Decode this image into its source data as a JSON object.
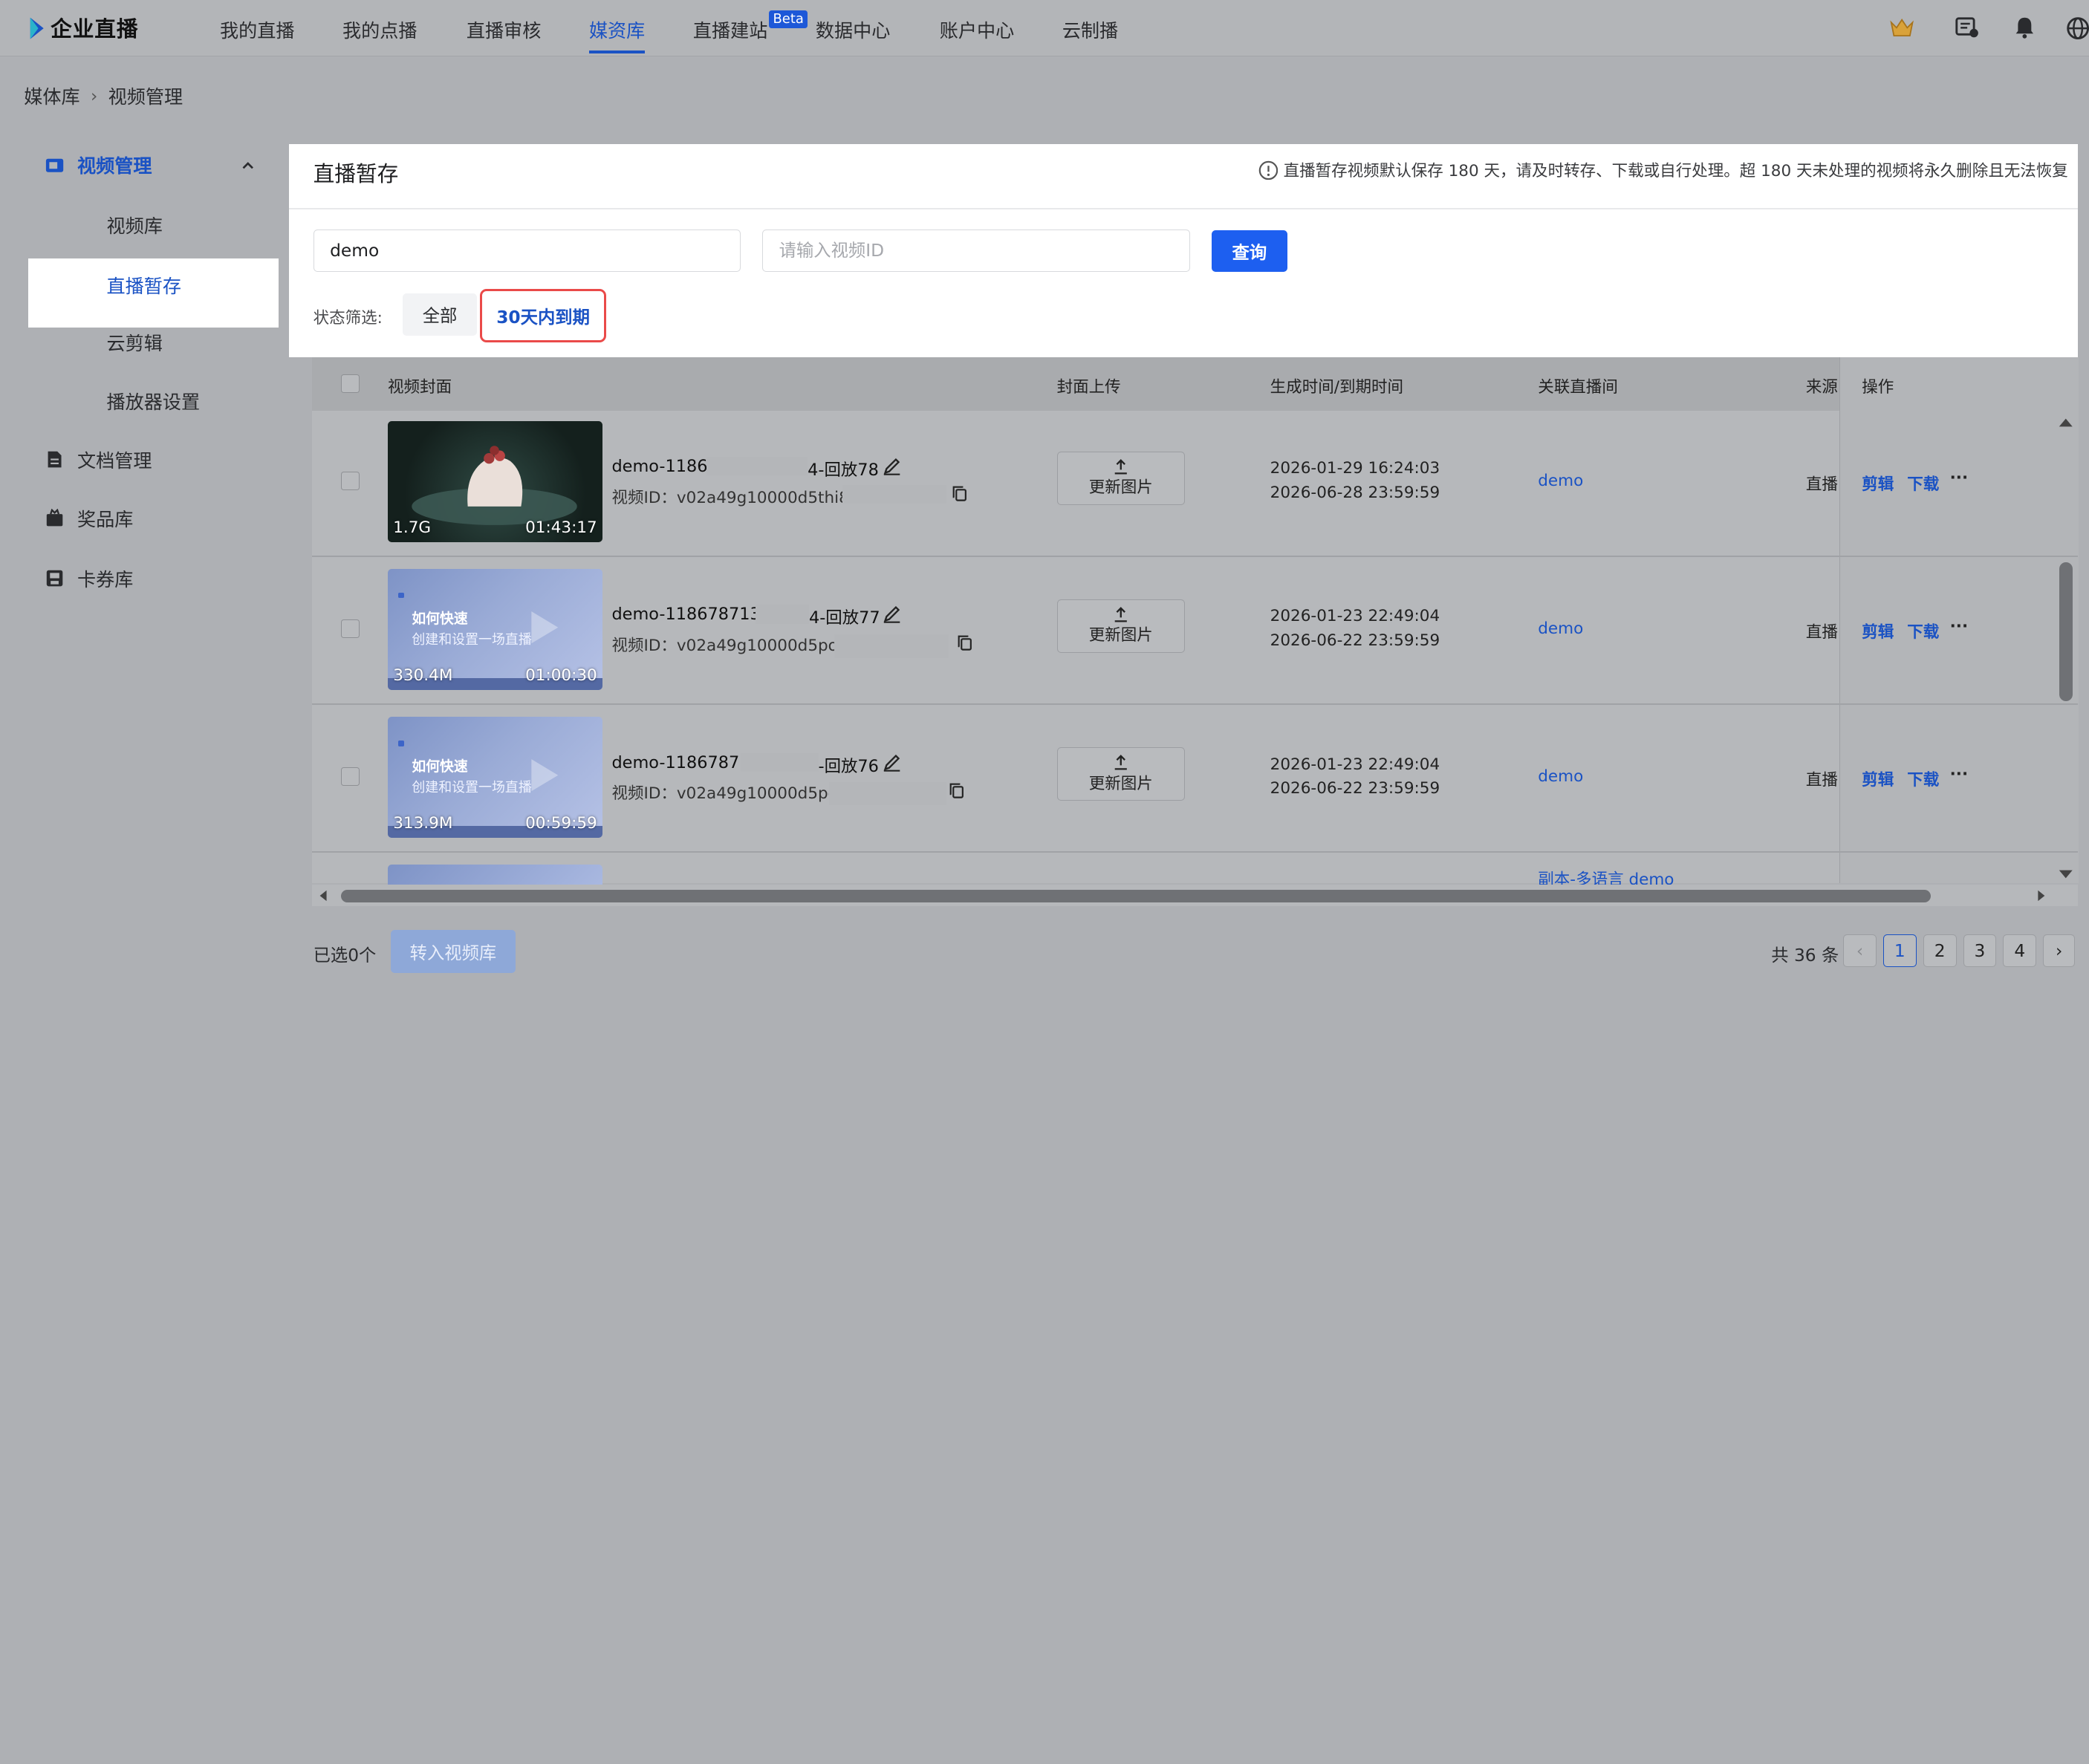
{
  "brand": {
    "name": "企业直播"
  },
  "nav": {
    "items": [
      {
        "label": "我的直播"
      },
      {
        "label": "我的点播"
      },
      {
        "label": "直播审核"
      },
      {
        "label": "媒资库",
        "active": true
      },
      {
        "label": "直播建站"
      },
      {
        "label": "数据中心"
      },
      {
        "label": "账户中心"
      },
      {
        "label": "云制播"
      }
    ],
    "beta_badge": "Beta"
  },
  "breadcrumb": {
    "root": "媒体库",
    "separator": "›",
    "current": "视频管理"
  },
  "sidebar": {
    "group_active": "视频管理",
    "sub_items": [
      "视频库",
      "直播暂存",
      "云剪辑",
      "播放器设置"
    ],
    "active_sub": "直播暂存",
    "groups": [
      "文档管理",
      "奖品库",
      "卡券库"
    ]
  },
  "header": {
    "title": "直播暂存",
    "notice": "直播暂存视频默认保存 180 天，请及时转存、下载或自行处理。超 180 天未处理的视频将永久删除且无法恢复"
  },
  "search": {
    "keyword_value": "demo",
    "id_placeholder": "请输入视频ID",
    "query_label": "查询"
  },
  "filter": {
    "label": "状态筛选:",
    "options": [
      "全部",
      "30天内到期"
    ],
    "active": "30天内到期"
  },
  "table": {
    "columns": [
      "视频封面",
      "封面上传",
      "生成时间/到期时间",
      "关联直播间",
      "来源",
      "操作"
    ],
    "upload_label": "更新图片",
    "rows": [
      {
        "size": "1.7G",
        "duration": "01:43:17",
        "title_a": "demo-11867",
        "title_b": "4-回放78",
        "vid_label": "视频ID：",
        "vid": "v02a49g10000d5thi8no",
        "created": "2026-01-29 16:24:03",
        "expires": "2026-06-28 23:59:59",
        "room": "demo",
        "source": "直播",
        "cover_style": "food"
      },
      {
        "size": "330.4M",
        "duration": "01:00:30",
        "title_a": "demo-118678713491",
        "title_b": "4-回放77",
        "vid_label": "视频ID：",
        "vid": "v02a49g10000d5pokn",
        "created": "2026-01-23 22:49:04",
        "expires": "2026-06-22 23:59:59",
        "room": "demo",
        "source": "直播",
        "cover_style": "blue",
        "cover_line1": "如何快速",
        "cover_line2": "创建和设置一场直播"
      },
      {
        "size": "313.9M",
        "duration": "00:59:59",
        "title_a": "demo-118678713",
        "title_b": "-回放76",
        "vid_label": "视频ID：",
        "vid": "v02a49g10000d5pok",
        "created": "2026-01-23 22:49:04",
        "expires": "2026-06-22 23:59:59",
        "room": "demo",
        "source": "直播",
        "cover_style": "blue",
        "cover_line1": "如何快速",
        "cover_line2": "创建和设置一场直播"
      }
    ],
    "partial_row_room": "副本-多语言 demo",
    "ops": {
      "edit": "剪辑",
      "download": "下载",
      "more": "···"
    }
  },
  "footer": {
    "selected": "已选0个",
    "transfer_label": "转入视频库",
    "total": "共 36 条",
    "pages": [
      "1",
      "2",
      "3",
      "4"
    ],
    "current_page": "1",
    "prev": "‹",
    "next": "›"
  },
  "colors": {
    "accent": "#1a52c4",
    "primary_button": "#1d5ff0",
    "highlight_border": "#ea4a49"
  }
}
